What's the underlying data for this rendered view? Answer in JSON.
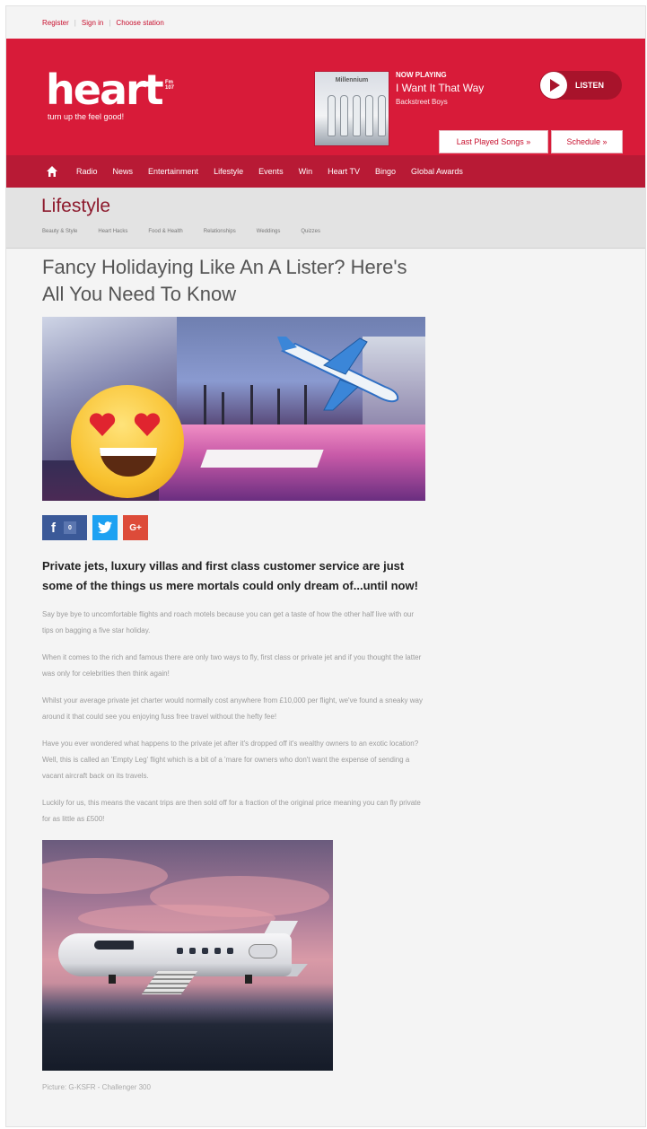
{
  "utility_bar": {
    "register": "Register",
    "sign_in": "Sign in",
    "choose_station": "Choose station",
    "separator": "|"
  },
  "header": {
    "logo_word": "heart",
    "logo_freq": "Fm 107",
    "logo_tagline": "turn up the feel good!",
    "album_title": "Millennium",
    "now_playing_label": "NOW PLAYING",
    "song": "I Want It That Way",
    "artist": "Backstreet Boys",
    "listen_label": "LISTEN",
    "last_played_label": "Last Played Songs »",
    "schedule_label": "Schedule »",
    "brand_color": "#d81b39"
  },
  "nav": {
    "items": [
      "Radio",
      "News",
      "Entertainment",
      "Lifestyle",
      "Events",
      "Win",
      "Heart TV",
      "Bingo",
      "Global Awards"
    ]
  },
  "section": {
    "title": "Lifestyle",
    "subnav": [
      "Beauty & Style",
      "Heart Hacks",
      "Food & Health",
      "Relationships",
      "Weddings",
      "Quizzes"
    ]
  },
  "article": {
    "headline": "Fancy Holidaying Like An A Lister? Here's All You Need To Know",
    "share": {
      "facebook_glyph": "f",
      "facebook_count": "0",
      "google_plus_glyph": "G+"
    },
    "lede": "Private jets, luxury villas and first class customer service are just some of the things us mere mortals could only dream of...until now!",
    "paragraphs": [
      "Say bye bye to uncomfortable flights and roach motels because you can get a taste of how the other half live with our tips on bagging a five star holiday.",
      "When it comes to the rich and famous there are only two ways to fly, first class or private jet and if you thought the latter was only for celebrities then think again!",
      "Whilst your average private jet charter would normally cost anywhere from £10,000 per flight, we've found a sneaky way around it that could see you enjoying fuss free travel without the hefty fee!",
      "Have you ever wondered what happens to the private jet after it's dropped off it's wealthy owners to an exotic location? Well, this is called an 'Empty Leg' flight which is a bit of a 'mare for owners who don't want the expense of sending a vacant aircraft back on its travels.",
      "Luckily for us, this means the vacant trips are then sold off for a fraction of the original price meaning you can fly private for as little as £500!"
    ],
    "caption": "Picture: G-KSFR - Challenger 300"
  },
  "icons": {
    "home": "home-icon",
    "play": "play-icon",
    "facebook": "facebook-icon",
    "twitter": "twitter-icon",
    "google_plus": "google-plus-icon"
  }
}
